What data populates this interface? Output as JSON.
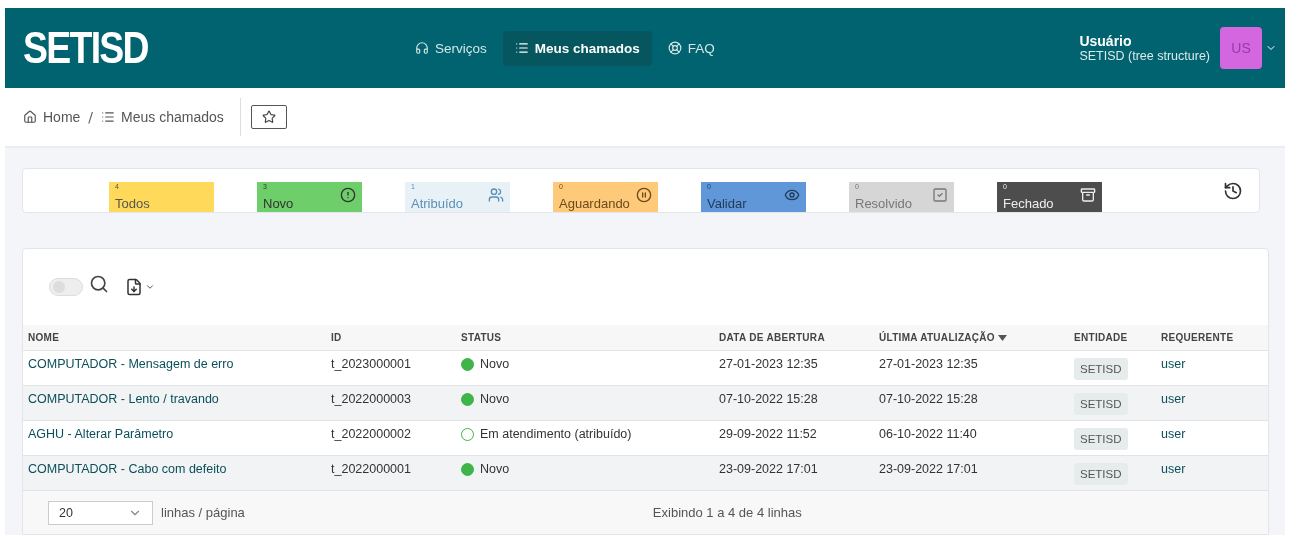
{
  "header": {
    "logo": "SETISD",
    "nav": [
      {
        "label": "Serviços",
        "selected": false
      },
      {
        "label": "Meus chamados",
        "selected": true
      },
      {
        "label": "FAQ",
        "selected": false
      }
    ],
    "user": {
      "name": "Usuário",
      "entity": "SETISD (tree structure)",
      "initials": "US"
    }
  },
  "breadcrumb": [
    {
      "label": "Home"
    },
    {
      "label": "Meus chamados"
    }
  ],
  "breadcrumb_separator": "/",
  "status_tiles": [
    {
      "kind": "todos",
      "count": "4",
      "label": "Todos",
      "color": "#ffd95a"
    },
    {
      "kind": "novo",
      "count": "3",
      "label": "Novo",
      "color": "#6dce6a"
    },
    {
      "kind": "atribuido",
      "count": "1",
      "label": "Atribuído",
      "color": "#e7f1f6"
    },
    {
      "kind": "aguardando",
      "count": "0",
      "label": "Aguardando",
      "color": "#ffc97a"
    },
    {
      "kind": "validar",
      "count": "0",
      "label": "Validar",
      "color": "#5f97d8"
    },
    {
      "kind": "resolvido",
      "count": "0",
      "label": "Resolvido",
      "color": "#d6d6d6"
    },
    {
      "kind": "fechado",
      "count": "0",
      "label": "Fechado",
      "color": "#4d4d4d"
    }
  ],
  "search_toggle": {
    "on": false
  },
  "table": {
    "columns": [
      {
        "label": "NOME",
        "sorted": false
      },
      {
        "label": "ID",
        "sorted": false
      },
      {
        "label": "STATUS",
        "sorted": false
      },
      {
        "label": "DATA DE ABERTURA",
        "sorted": false
      },
      {
        "label": "ÚLTIMA ATUALIZAÇÃO",
        "sorted": true
      },
      {
        "label": "ENTIDADE",
        "sorted": false
      },
      {
        "label": "REQUERENTE",
        "sorted": false
      }
    ],
    "rows": [
      {
        "name": "COMPUTADOR - Mensagem de erro",
        "id": "t_2023000001",
        "status_filled": true,
        "status": "Novo",
        "opened": "27-01-2023 12:35",
        "updated": "27-01-2023 12:35",
        "entity": "SETISD",
        "requester": "user"
      },
      {
        "name": "COMPUTADOR - Lento / travando",
        "id": "t_2022000003",
        "status_filled": true,
        "status": "Novo",
        "opened": "07-10-2022 15:28",
        "updated": "07-10-2022 15:28",
        "entity": "SETISD",
        "requester": "user"
      },
      {
        "name": "AGHU - Alterar Parâmetro",
        "id": "t_2022000002",
        "status_filled": false,
        "status": "Em atendimento (atribuído)",
        "opened": "29-09-2022 11:52",
        "updated": "06-10-2022 11:40",
        "entity": "SETISD",
        "requester": "user"
      },
      {
        "name": "COMPUTADOR - Cabo com defeito",
        "id": "t_2022000001",
        "status_filled": true,
        "status": "Novo",
        "opened": "23-09-2022 17:01",
        "updated": "23-09-2022 17:01",
        "entity": "SETISD",
        "requester": "user"
      }
    ]
  },
  "pagination": {
    "page_size": "20",
    "page_size_label": "linhas / página",
    "summary": "Exibindo 1 a 4 de 4 linhas"
  }
}
